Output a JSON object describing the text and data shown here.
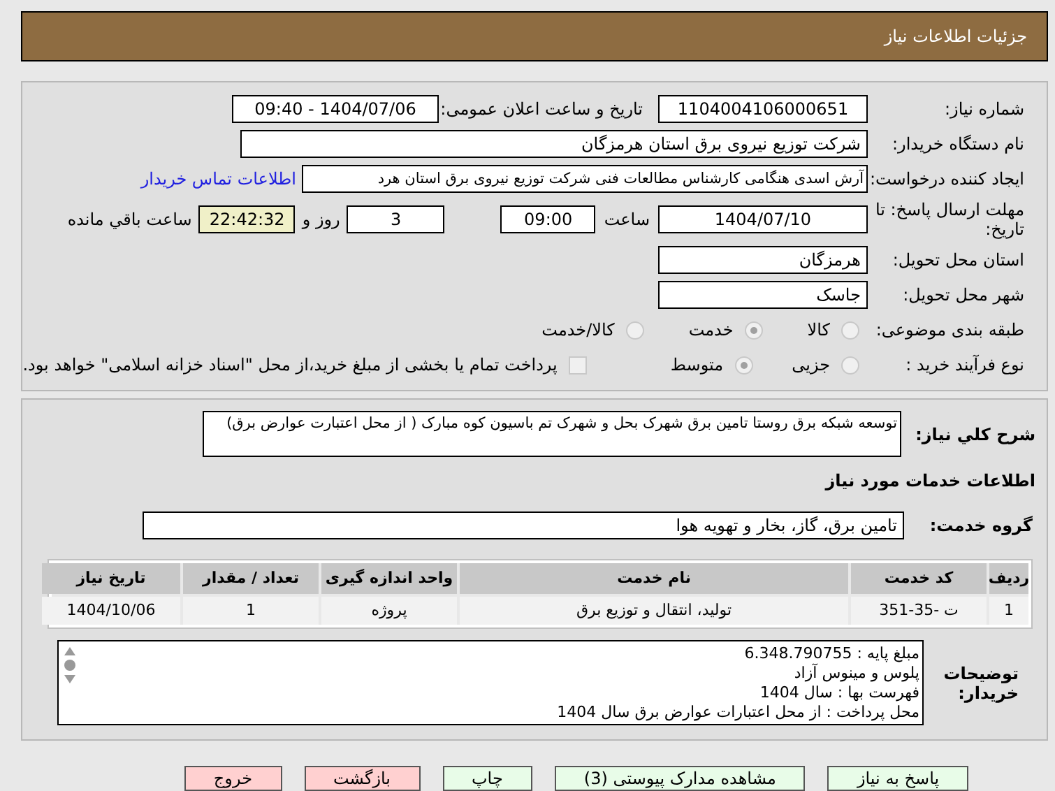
{
  "header": {
    "title": "جزئیات اطلاعات نیاز"
  },
  "need_number": {
    "label": "شماره نیاز:",
    "value": "1104004106000651"
  },
  "announce_date": {
    "label": "تاریخ و ساعت اعلان عمومی:",
    "value": "1404/07/06 - 09:40"
  },
  "buyer_org": {
    "label": "نام دستگاه خریدار:",
    "value": "شرکت توزیع نیروی برق استان هرمزگان"
  },
  "requester": {
    "label": "ایجاد کننده درخواست:",
    "value": "آرش اسدی هنگامی کارشناس مطالعات فنی شرکت توزیع نیروی برق استان هرد",
    "link": "اطلاعات تماس خریدار"
  },
  "deadline": {
    "label": "مهلت ارسال پاسخ: تا تاریخ:",
    "date": "1404/07/10",
    "time_label": "ساعت",
    "time": "09:00",
    "days": "3",
    "days_label": "روز و",
    "remaining": "22:42:32",
    "remaining_label": "ساعت باقي مانده"
  },
  "province": {
    "label": "استان محل تحویل:",
    "value": "هرمزگان"
  },
  "city": {
    "label": "شهر محل تحویل:",
    "value": "جاسک"
  },
  "category": {
    "label": "طبقه بندی موضوعی:",
    "options": [
      {
        "label": "کالا",
        "selected": false
      },
      {
        "label": "خدمت",
        "selected": true
      },
      {
        "label": "کالا/خدمت",
        "selected": false
      }
    ]
  },
  "purchase_type": {
    "label": "نوع فرآیند خرید :",
    "options": [
      {
        "label": "جزیی",
        "selected": false
      },
      {
        "label": "متوسط",
        "selected": true
      }
    ],
    "treasury": {
      "checked": false,
      "text": "پرداخت تمام یا بخشی از مبلغ خرید،از محل \"اسناد خزانه اسلامی\" خواهد بود."
    }
  },
  "description": {
    "label": "شرح کلي نیاز:",
    "value": "توسعه شبکه برق روستا تامین برق شهرک بحل و شهرک تم باسیون کوه مبارک ( از محل اعتبارت عوارض برق)"
  },
  "services_title": "اطلاعات خدمات مورد نیاز",
  "service_group": {
    "label": "گروه خدمت:",
    "value": "تامین برق، گاز، بخار و تهویه هوا"
  },
  "table": {
    "columns": [
      "ردیف",
      "کد خدمت",
      "نام خدمت",
      "واحد اندازه گیری",
      "تعداد / مقدار",
      "تاریخ نیاز"
    ],
    "rows": [
      [
        "1",
        "ت -35-351",
        "تولید، انتقال و توزیع برق",
        "پروژه",
        "1",
        "1404/10/06"
      ]
    ]
  },
  "buyer_notes": {
    "label": "توضیحات خریدار:",
    "lines": [
      "مبلغ پایه : 6.348.790755",
      "پلوس و مینوس آزاد",
      "فهرست بها : سال 1404",
      "محل پرداخت : از محل اعتبارات عوارض برق سال 1404"
    ]
  },
  "buttons": [
    {
      "label": "پاسخ به نیاز",
      "kind": "primary"
    },
    {
      "label": "مشاهده مدارک پیوستی (3)",
      "kind": "primary"
    },
    {
      "label": "چاپ",
      "kind": "primary"
    },
    {
      "label": "بازگشت",
      "kind": "danger"
    },
    {
      "label": "خروج",
      "kind": "danger"
    }
  ]
}
